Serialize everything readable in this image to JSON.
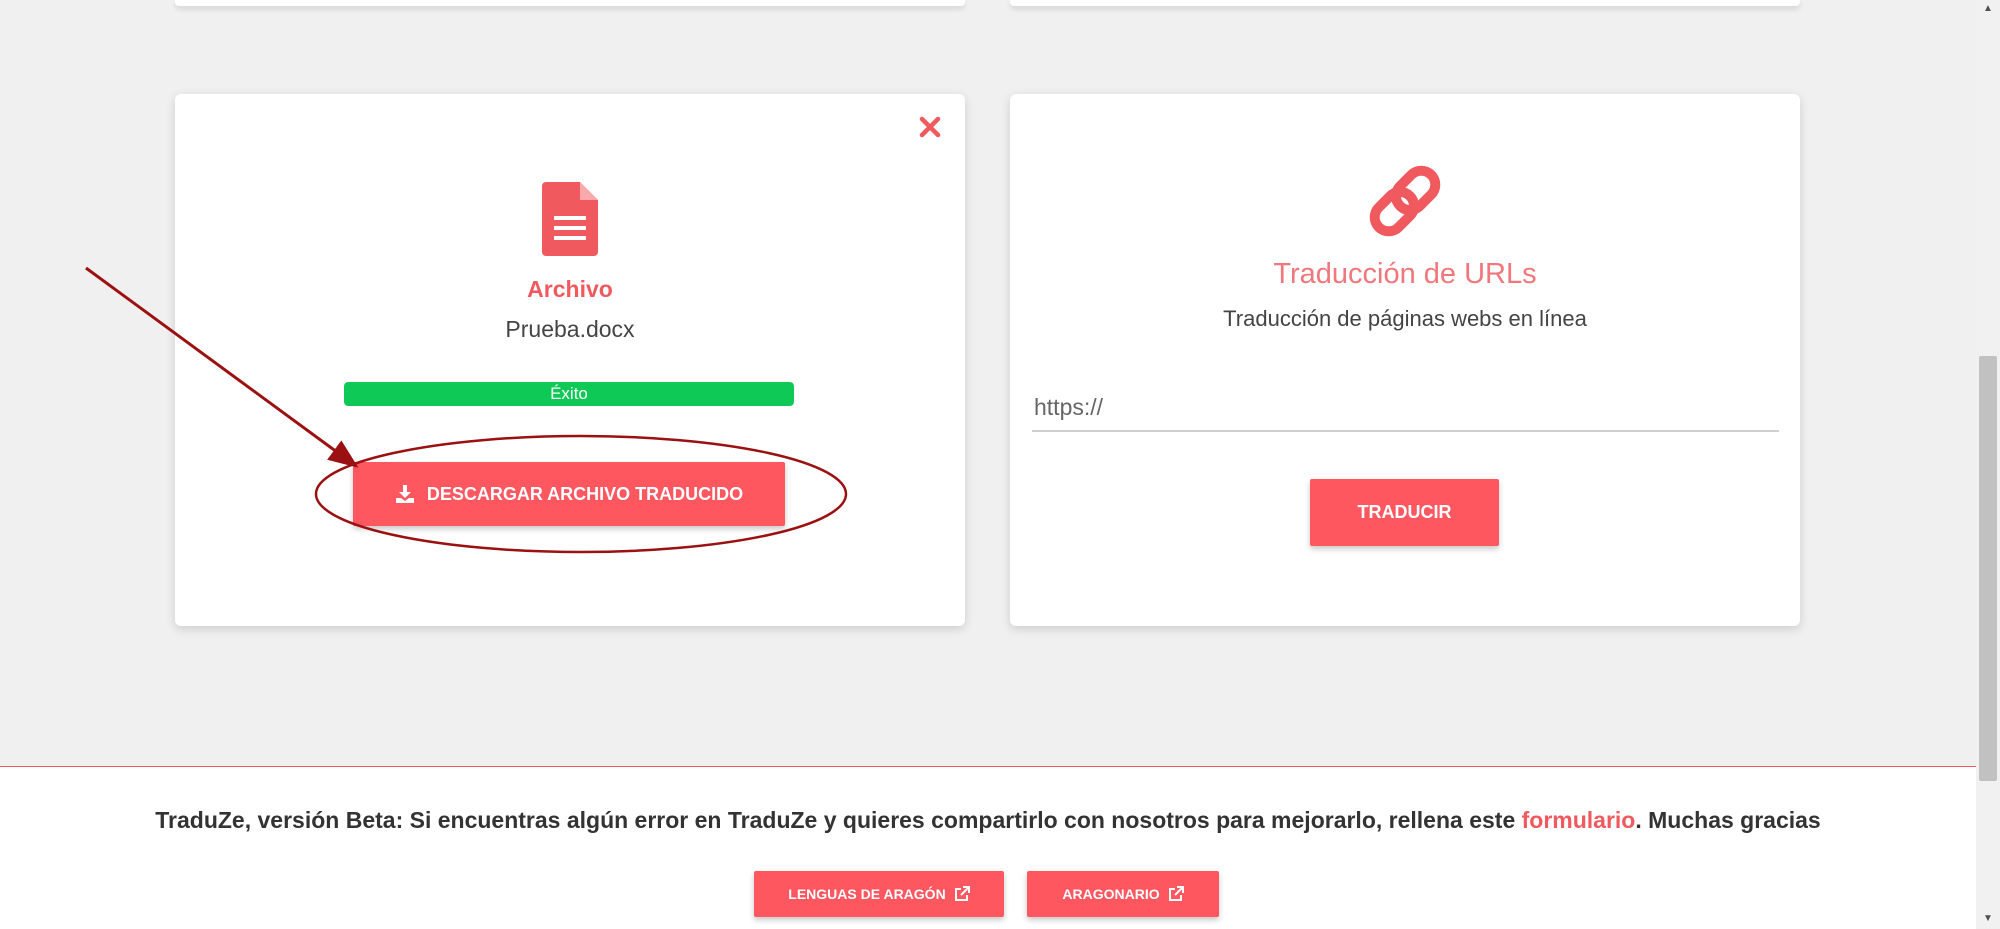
{
  "colors": {
    "accent": "#fe5760",
    "success": "#0fc957",
    "annotation": "#9b1010"
  },
  "file_card": {
    "title": "Archivo",
    "file_name": "Prueba.docx",
    "progress_label": "Éxito",
    "progress": 1.0,
    "download_label": "DESCARGAR ARCHIVO TRADUCIDO",
    "icons": [
      "close-icon",
      "file-document-icon",
      "download-icon"
    ]
  },
  "url_card": {
    "title": "Traducción de URLs",
    "subtitle": "Traducción de páginas webs en línea",
    "input_placeholder": "https://",
    "input_value": "",
    "translate_label": "TRADUCIR",
    "icons": [
      "link-icon"
    ]
  },
  "footer": {
    "text_before": "TraduZe, versión Beta: Si encuentras algún error en TraduZe y quieres compartirlo con nosotros para mejorarlo, rellena este ",
    "link_text": "formulario",
    "text_after": ". Muchas gracias",
    "buttons": [
      "LENGUAS DE ARAGÓN",
      "ARAGONARIO"
    ],
    "icons": [
      "external-link-icon"
    ]
  }
}
